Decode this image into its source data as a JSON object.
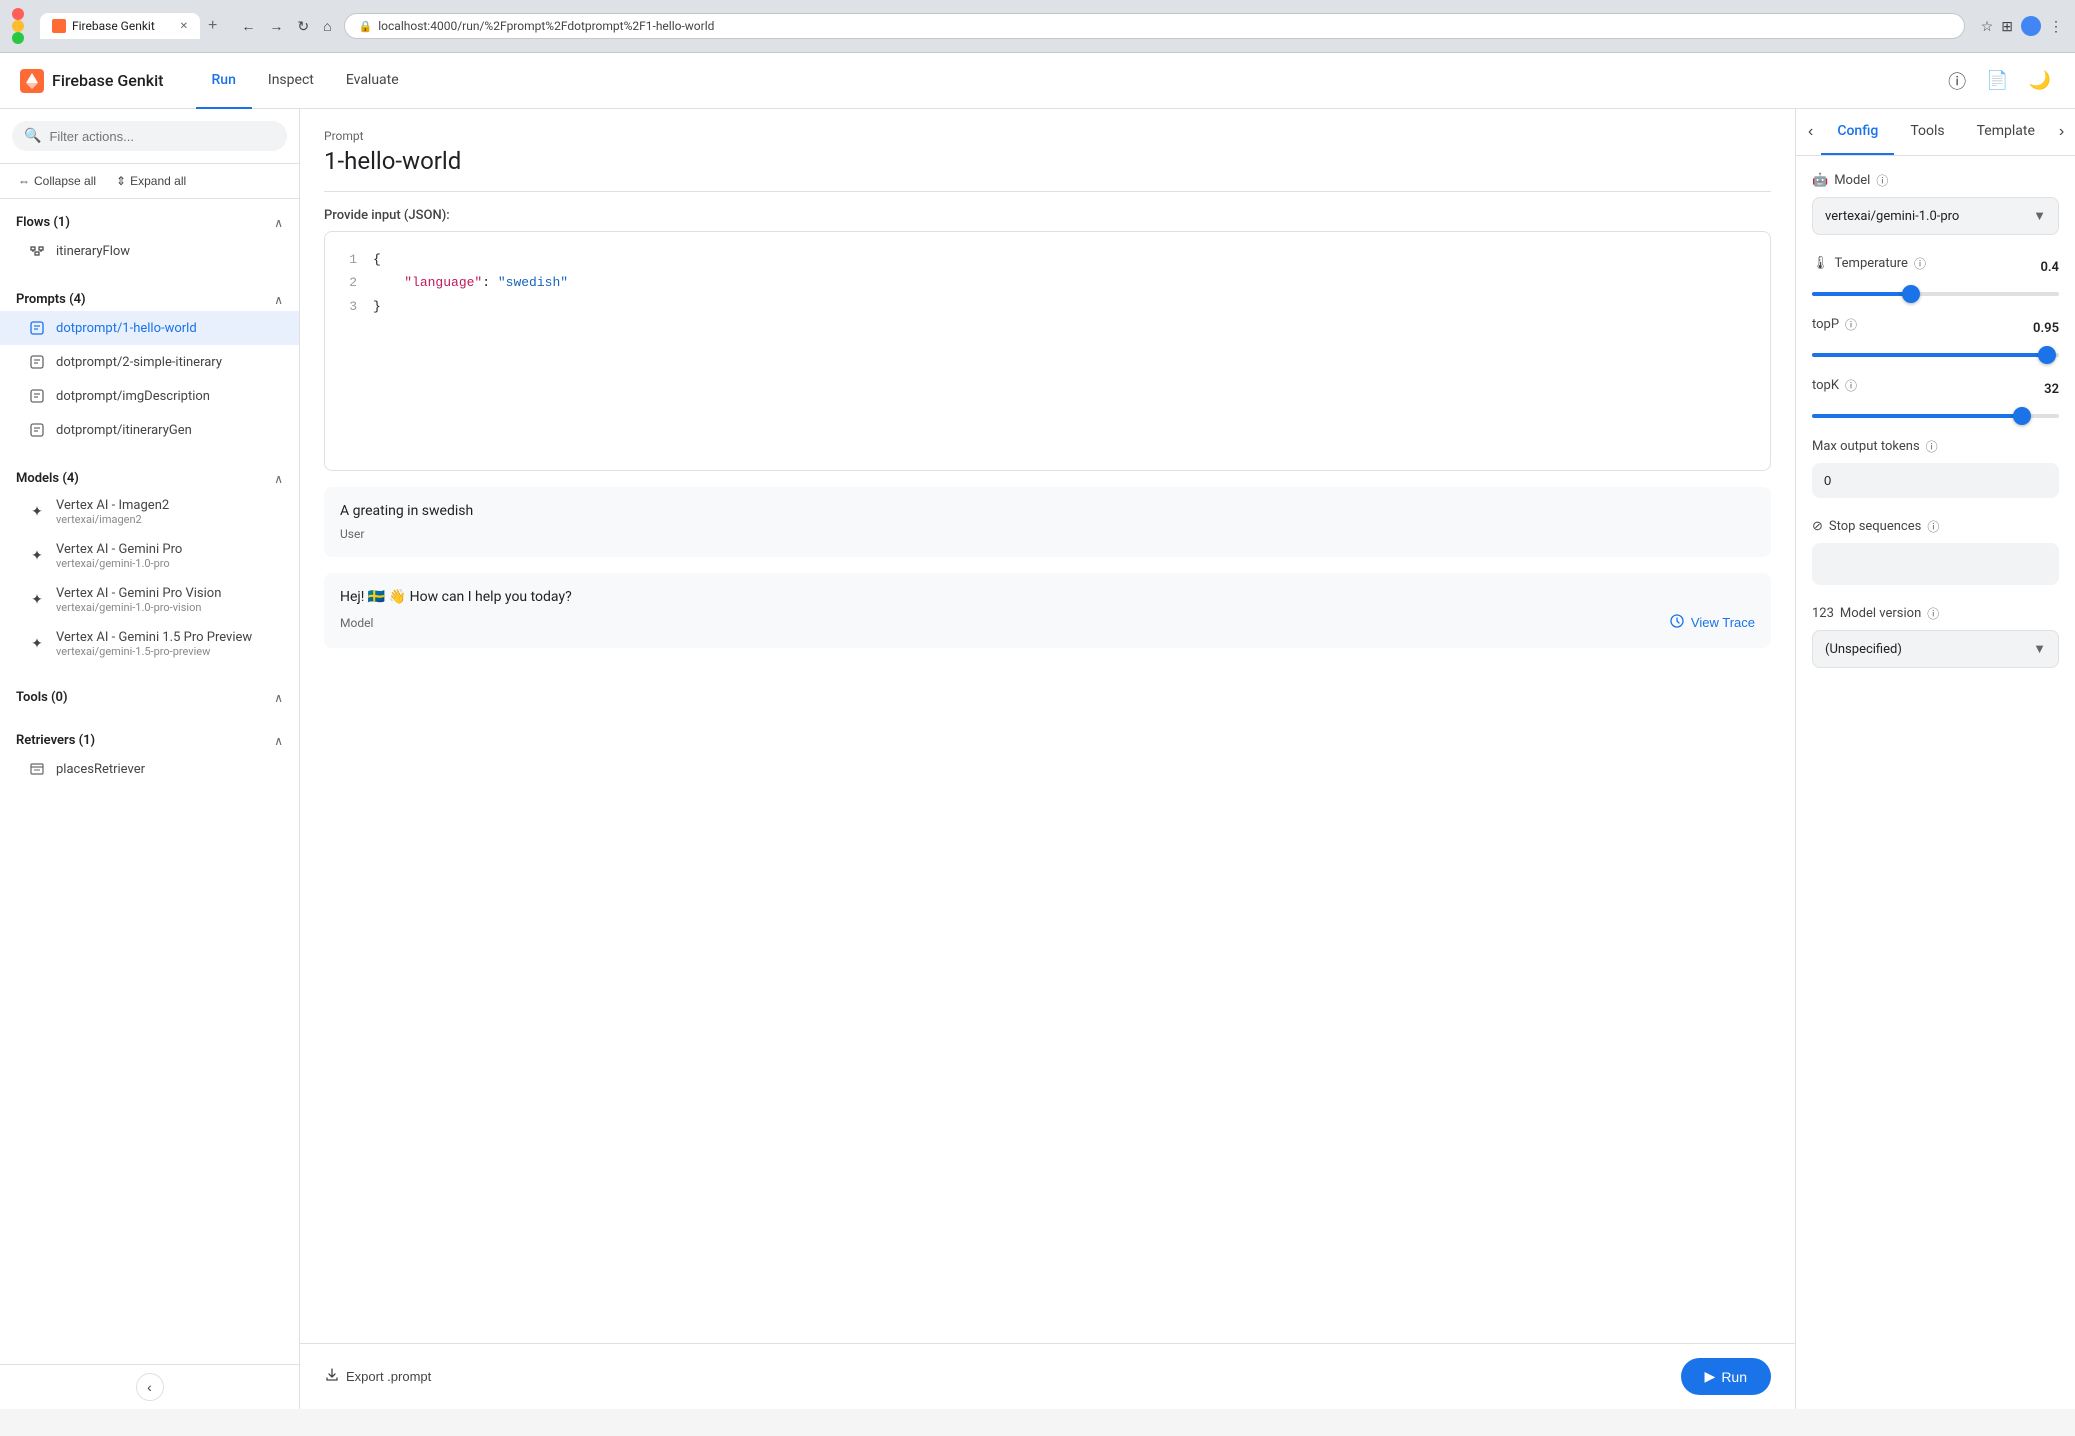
{
  "browser": {
    "tab_title": "Firebase Genkit",
    "url": "localhost:4000/run/%2Fprompt%2Fdotprompt%2F1-hello-world",
    "new_tab_label": "+",
    "back_label": "←",
    "forward_label": "→",
    "refresh_label": "↻",
    "home_label": "⌂",
    "star_label": "☆",
    "extensions_label": "⊞",
    "menu_label": "⋮",
    "zoom_label": "▼"
  },
  "app": {
    "logo_text": "Firebase Genkit",
    "nav": [
      {
        "label": "Run",
        "active": true
      },
      {
        "label": "Inspect",
        "active": false
      },
      {
        "label": "Evaluate",
        "active": false
      }
    ],
    "header_icons": [
      "ⓘ",
      "📄",
      "🌙"
    ]
  },
  "sidebar": {
    "search_placeholder": "Filter actions...",
    "collapse_label": "Collapse all",
    "expand_label": "Expand all",
    "sections": [
      {
        "title": "Flows (1)",
        "expanded": true,
        "items": [
          {
            "label": "itineraryFlow",
            "icon": "flow",
            "active": false
          }
        ]
      },
      {
        "title": "Prompts (4)",
        "expanded": true,
        "items": [
          {
            "label": "dotprompt/1-hello-world",
            "icon": "prompt",
            "active": true
          },
          {
            "label": "dotprompt/2-simple-itinerary",
            "icon": "prompt",
            "active": false
          },
          {
            "label": "dotprompt/imgDescription",
            "icon": "prompt",
            "active": false
          },
          {
            "label": "dotprompt/itineraryGen",
            "icon": "prompt",
            "active": false
          }
        ]
      },
      {
        "title": "Models (4)",
        "expanded": true,
        "items": [
          {
            "label": "Vertex AI - Imagen2",
            "sublabel": "vertexai/imagen2",
            "icon": "model",
            "active": false
          },
          {
            "label": "Vertex AI - Gemini Pro",
            "sublabel": "vertexai/gemini-1.0-pro",
            "icon": "model",
            "active": false
          },
          {
            "label": "Vertex AI - Gemini Pro Vision",
            "sublabel": "vertexai/gemini-1.0-pro-vision",
            "icon": "model",
            "active": false
          },
          {
            "label": "Vertex AI - Gemini 1.5 Pro Preview",
            "sublabel": "vertexai/gemini-1.5-pro-preview",
            "icon": "model",
            "active": false
          }
        ]
      },
      {
        "title": "Tools (0)",
        "expanded": true,
        "items": []
      },
      {
        "title": "Retrievers (1)",
        "expanded": true,
        "items": [
          {
            "label": "placesRetriever",
            "icon": "retriever",
            "active": false
          }
        ]
      }
    ],
    "collapse_icon": "‹"
  },
  "main": {
    "prompt_label": "Prompt",
    "prompt_title": "1-hello-world",
    "input_section_label": "Provide input (JSON):",
    "json_lines": [
      {
        "num": "1",
        "content": "{"
      },
      {
        "num": "2",
        "content": "    \"language\": \"swedish\""
      },
      {
        "num": "3",
        "content": "}"
      }
    ],
    "message_user": {
      "text": "A greating in swedish",
      "role": "User"
    },
    "message_model": {
      "text": "Hej! 🇸🇪 👋 How can I help you today?",
      "role": "Model",
      "view_trace_label": "View Trace"
    },
    "export_label": "Export .prompt",
    "run_label": "Run"
  },
  "right_panel": {
    "tabs": [
      {
        "label": "Config",
        "active": true
      },
      {
        "label": "Tools",
        "active": false
      },
      {
        "label": "Template",
        "active": false
      }
    ],
    "prev_icon": "‹",
    "next_icon": "›",
    "model": {
      "label": "Model",
      "value": "vertexai/gemini-1.0-pro",
      "icon": "🤖"
    },
    "temperature": {
      "label": "Temperature",
      "value": "0.4",
      "min": 0,
      "max": 1,
      "current": 0.4,
      "fill_pct": 40,
      "thumb_pct": 40
    },
    "topP": {
      "label": "topP",
      "value": "0.95",
      "min": 0,
      "max": 1,
      "current": 0.95,
      "fill_pct": 95,
      "thumb_pct": 95
    },
    "topK": {
      "label": "topK",
      "value": "32",
      "min": 0,
      "max": 64,
      "current": 32,
      "fill_pct": 85,
      "thumb_pct": 85
    },
    "max_output_tokens": {
      "label": "Max output tokens",
      "value": "0"
    },
    "stop_sequences": {
      "label": "Stop sequences",
      "value": ""
    },
    "model_version": {
      "label": "Model version",
      "value": "(Unspecified)"
    }
  }
}
